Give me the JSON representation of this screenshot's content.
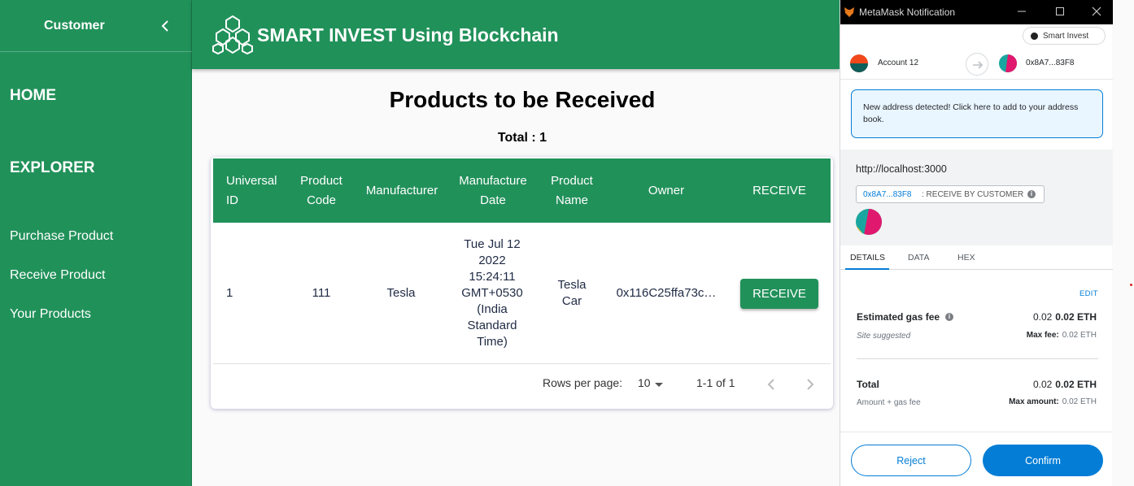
{
  "sidebar": {
    "title": "Customer",
    "home": "HOME",
    "explorer": "EXPLORER",
    "links": [
      "Purchase Product",
      "Receive Product",
      "Your Products"
    ]
  },
  "header": {
    "title": "SMART INVEST Using Blockchain"
  },
  "page": {
    "title": "Products to be Received",
    "total": "Total : 1"
  },
  "table": {
    "headers": [
      "Universal\nID",
      "Product\nCode",
      "Manufacturer",
      "Manufacture\nDate",
      "Product\nName",
      "Owner",
      "RECEIVE"
    ],
    "row": {
      "id": "1",
      "code": "111",
      "manufacturer": "Tesla",
      "date": "Tue Jul 12\n2022\n15:24:11\nGMT+0530\n(India\nStandard\nTime)",
      "name": "Tesla\nCar",
      "owner": "0x116C25ffa73c…",
      "action": "RECEIVE"
    },
    "pagination": {
      "rows_label": "Rows per page:",
      "rows_value": "10",
      "range": "1-1 of 1"
    }
  },
  "metamask": {
    "window_title": "MetaMask Notification",
    "network": "Smart Invest",
    "from_account": "Account 12",
    "to_address": "0x8A7...83F8",
    "notice": "New address detected! Click here to add to your address book.",
    "origin": "http://localhost:3000",
    "method_address": "0x8A7...83F8",
    "method_name": ": RECEIVE BY CUSTOMER",
    "tabs": [
      "DETAILS",
      "DATA",
      "HEX"
    ],
    "edit": "EDIT",
    "gas": {
      "label": "Estimated gas fee",
      "value": "0.02",
      "value_bold": "0.02 ETH",
      "sub": "Site suggested",
      "max_label": "Max fee:",
      "max_value": "0.02 ETH"
    },
    "total": {
      "label": "Total",
      "value": "0.02",
      "value_bold": "0.02 ETH",
      "sub": "Amount + gas fee",
      "max_label": "Max amount:",
      "max_value": "0.02 ETH"
    },
    "reject": "Reject",
    "confirm": "Confirm",
    "colors": {
      "accent": "#037dd6",
      "app_green": "#21915a"
    }
  }
}
